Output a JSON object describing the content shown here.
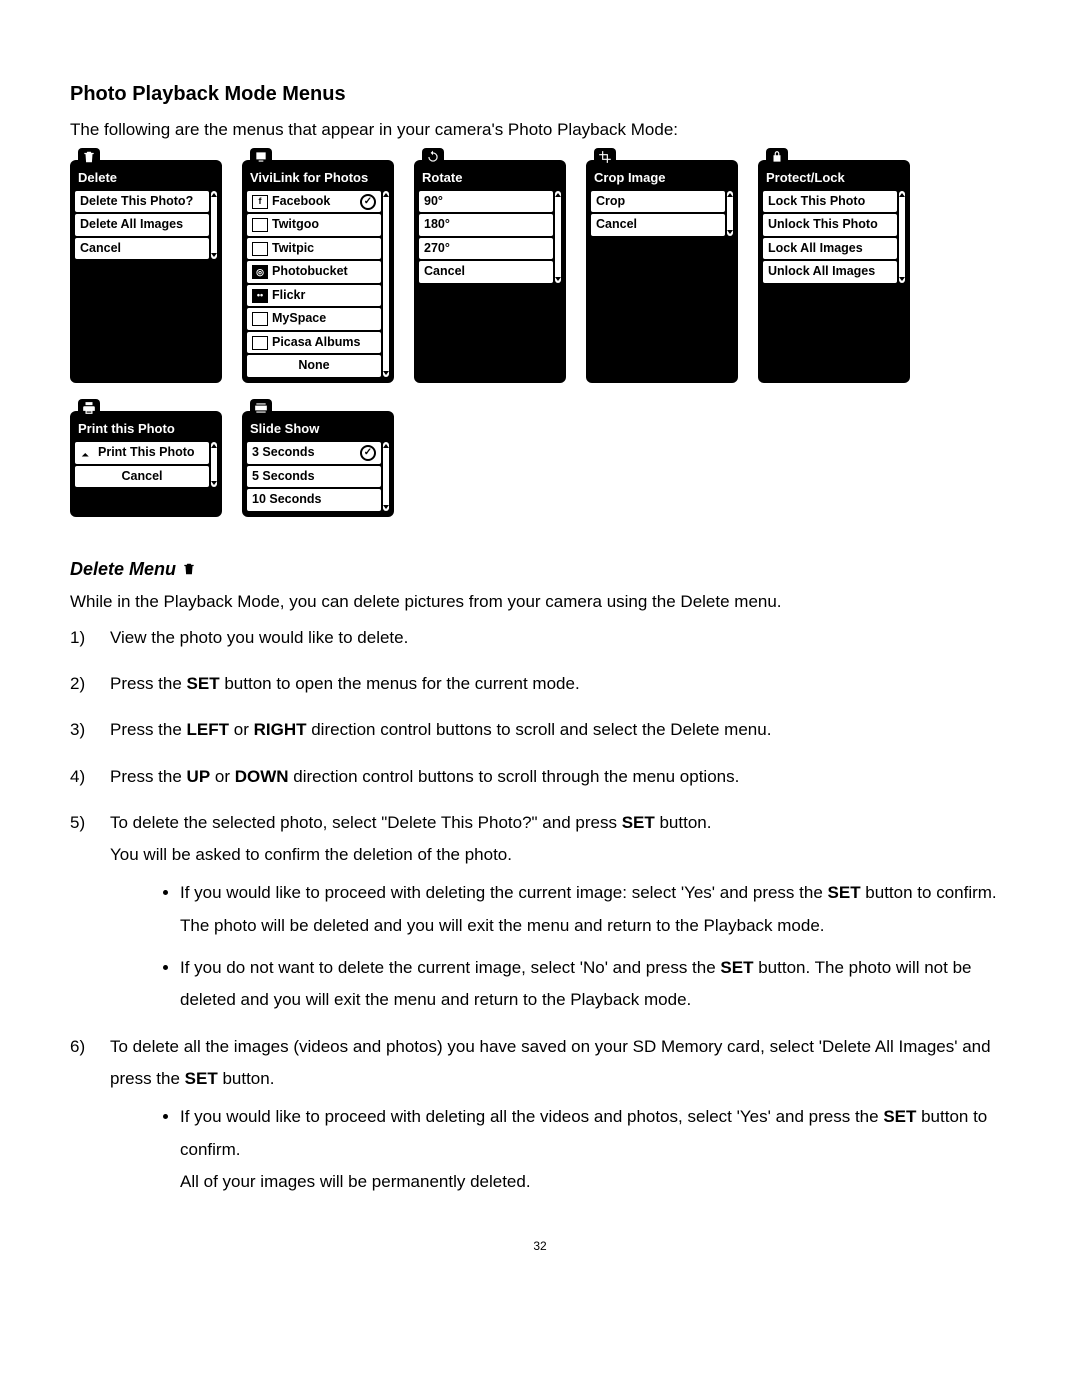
{
  "page": {
    "title": "Photo Playback Mode Menus",
    "intro": "The following are the menus that appear in your camera's Photo Playback Mode:",
    "number": "32"
  },
  "menus": {
    "delete": {
      "title": "Delete",
      "items": [
        "Delete This Photo?",
        "Delete All Images",
        "Cancel"
      ]
    },
    "vivilink": {
      "title": "ViviLink for Photos",
      "items": [
        "Facebook",
        "Twitgoo",
        "Twitpic",
        "Photobucket",
        "Flickr",
        "MySpace",
        "Picasa Albums",
        "None"
      ]
    },
    "rotate": {
      "title": "Rotate",
      "items": [
        "90°",
        "180°",
        "270°",
        "Cancel"
      ]
    },
    "crop": {
      "title": "Crop Image",
      "items": [
        "Crop",
        "Cancel"
      ]
    },
    "protect": {
      "title": "Protect/Lock",
      "items": [
        "Lock This Photo",
        "Unlock This Photo",
        "Lock All Images",
        "Unlock All Images"
      ]
    },
    "print": {
      "title": "Print this Photo",
      "items": [
        "Print This Photo",
        "Cancel"
      ]
    },
    "slideshow": {
      "title": "Slide Show",
      "items": [
        "3 Seconds",
        "5 Seconds",
        "10 Seconds"
      ]
    }
  },
  "section": {
    "heading": "Delete Menu",
    "intro": "While in the Playback Mode, you can delete pictures from your camera using the Delete menu.",
    "steps": {
      "s1": "View the photo you would like to delete.",
      "s2_a": "Press the ",
      "s2_b": "SET",
      "s2_c": " button to open the menus for the current mode.",
      "s3_a": "Press the ",
      "s3_b": "LEFT",
      "s3_c": " or ",
      "s3_d": "RIGHT",
      "s3_e": " direction control buttons to scroll and select the Delete menu.",
      "s4_a": "Press the ",
      "s4_b": "UP",
      "s4_c": " or ",
      "s4_d": "DOWN",
      "s4_e": " direction control buttons to scroll through the menu options.",
      "s5_a": "To delete the selected photo, select \"Delete This Photo?\" and press ",
      "s5_b": "SET",
      "s5_c": " button.",
      "s5_line2": "You will be asked to confirm the deletion of the photo.",
      "s5_b1_a": "If you would like to proceed with deleting the current image: select 'Yes' and press the ",
      "s5_b1_b": "SET",
      "s5_b1_c": " button to confirm. The photo will be deleted and you will exit the menu and return to the Playback mode.",
      "s5_b2_a": "If you do not want to delete the current image, select 'No' and press the ",
      "s5_b2_b": "SET",
      "s5_b2_c": " button. The photo will not be deleted and you will exit the menu and return to the Playback mode.",
      "s6_a": "To delete all the images (videos and photos) you have saved on your SD Memory card, select 'Delete All Images' and press the ",
      "s6_b": "SET",
      "s6_c": " button.",
      "s6_b1_a": "If you would like to proceed with deleting all the videos and photos, select 'Yes' and press the ",
      "s6_b1_b": "SET",
      "s6_b1_c": " button to confirm.",
      "s6_b1_line2": "All of your images will be permanently deleted."
    }
  }
}
